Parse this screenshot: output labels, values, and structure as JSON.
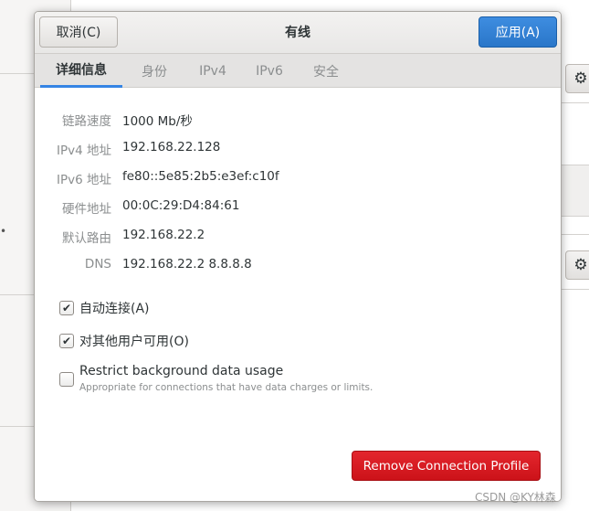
{
  "dialog": {
    "title": "有线",
    "cancel_label": "取消(C)",
    "apply_label": "应用(A)"
  },
  "tabs": [
    {
      "label": "详细信息",
      "active": true
    },
    {
      "label": "身份",
      "active": false
    },
    {
      "label": "IPv4",
      "active": false
    },
    {
      "label": "IPv6",
      "active": false
    },
    {
      "label": "安全",
      "active": false
    }
  ],
  "details": [
    {
      "label": "链路速度",
      "value": "1000 Mb/秒"
    },
    {
      "label": "IPv4 地址",
      "value": "192.168.22.128"
    },
    {
      "label": "IPv6 地址",
      "value": "fe80::5e85:2b5:e3ef:c10f"
    },
    {
      "label": "硬件地址",
      "value": "00:0C:29:D4:84:61"
    },
    {
      "label": "默认路由",
      "value": "192.168.22.2"
    },
    {
      "label": "DNS",
      "value": "192.168.22.2 8.8.8.8"
    }
  ],
  "options": {
    "auto_connect": {
      "label": "自动连接(A)",
      "checked": true
    },
    "all_users": {
      "label": "对其他用户可用(O)",
      "checked": true
    },
    "restrict_bg": {
      "label": "Restrict background data usage",
      "description": "Appropriate for connections that have data charges or limits.",
      "checked": false
    }
  },
  "remove_label": "Remove Connection Profile",
  "watermark": "CSDN @KY林森",
  "icons": {
    "background_gear": "gear-icon",
    "checkmark": "check-icon"
  },
  "colors": {
    "accent": "#3584e4",
    "apply": "#2a76c9",
    "destructive": "#cc1219"
  }
}
